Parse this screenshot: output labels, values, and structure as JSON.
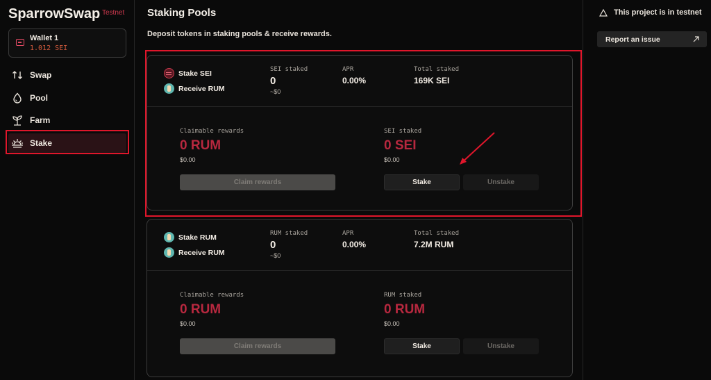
{
  "app": {
    "brand": "SparrowSwap",
    "network_tag": "Testnet"
  },
  "wallet": {
    "name": "Wallet 1",
    "balance": "1.012 SEI"
  },
  "nav": [
    {
      "label": "Swap",
      "icon": "swap-icon"
    },
    {
      "label": "Pool",
      "icon": "drop-icon"
    },
    {
      "label": "Farm",
      "icon": "sprout-icon"
    },
    {
      "label": "Stake",
      "icon": "sunrise-icon",
      "active": true
    }
  ],
  "page": {
    "title": "Staking Pools",
    "subtitle": "Deposit tokens in staking pools & receive rewards."
  },
  "pools": [
    {
      "stake_label": "Stake SEI",
      "receive_label": "Receive RUM",
      "staked_label": "SEI staked",
      "staked_value": "0",
      "staked_usd": "~$0",
      "apr_label": "APR",
      "apr_value": "0.00%",
      "total_label": "Total staked",
      "total_value": "169K SEI",
      "claimable_label": "Claimable rewards",
      "claimable_value": "0 RUM",
      "claimable_usd": "$0.00",
      "user_staked_label": "SEI staked",
      "user_staked_value": "0 SEI",
      "user_staked_usd": "$0.00",
      "claim_btn": "Claim rewards",
      "stake_btn": "Stake",
      "unstake_btn": "Unstake"
    },
    {
      "stake_label": "Stake RUM",
      "receive_label": "Receive RUM",
      "staked_label": "RUM staked",
      "staked_value": "0",
      "staked_usd": "~$0",
      "apr_label": "APR",
      "apr_value": "0.00%",
      "total_label": "Total staked",
      "total_value": "7.2M RUM",
      "claimable_label": "Claimable rewards",
      "claimable_value": "0 RUM",
      "claimable_usd": "$0.00",
      "user_staked_label": "RUM staked",
      "user_staked_value": "0 RUM",
      "user_staked_usd": "$0.00",
      "claim_btn": "Claim rewards",
      "stake_btn": "Stake",
      "unstake_btn": "Unstake"
    }
  ],
  "right": {
    "testnet_notice": "This project is in testnet",
    "report_label": "Report an issue"
  },
  "colors": {
    "accent": "#b8283f",
    "highlight": "#e0162b",
    "background": "#0a0a0a"
  }
}
